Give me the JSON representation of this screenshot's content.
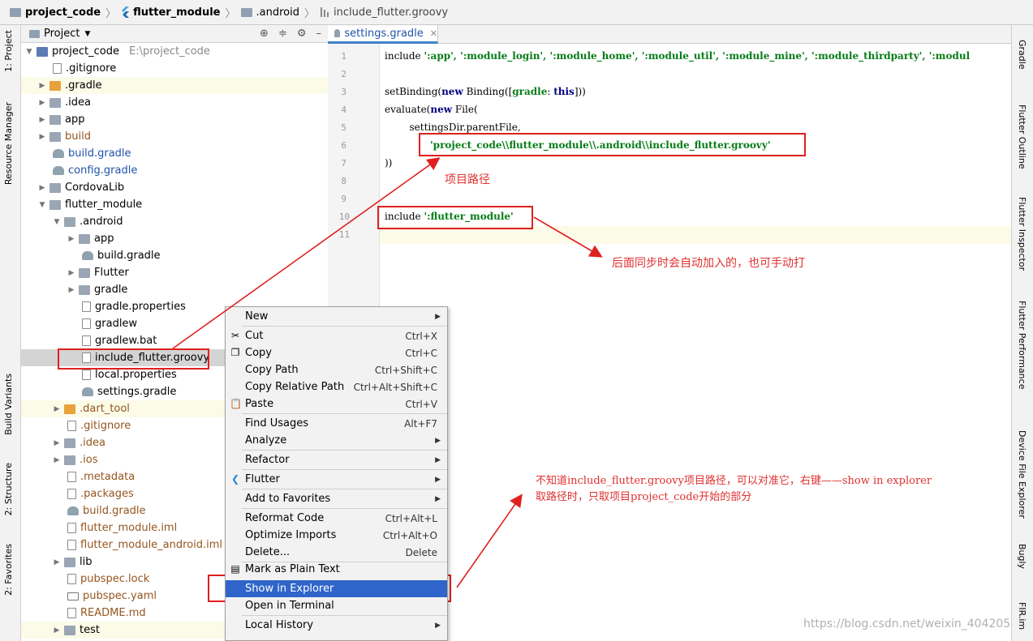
{
  "breadcrumb": {
    "root": "project_code",
    "module": "flutter_module",
    "android": ".android",
    "file": "include_flutter.groovy"
  },
  "left_tool_tabs": {
    "project": "1: Project",
    "resource_manager": "Resource Manager",
    "build_variants": "Build Variants",
    "structure": "2: Structure",
    "favorites": "2: Favorites"
  },
  "right_tool_tabs": {
    "gradle": "Gradle",
    "flutter_outline": "Flutter Outline",
    "flutter_inspector": "Flutter Inspector",
    "flutter_performance": "Flutter Performance",
    "device_file_explorer": "Device File Explorer",
    "bugly": "Bugly",
    "fir": "FIR.im"
  },
  "project_panel": {
    "title": "Project",
    "root_path": "E:\\project_code"
  },
  "tree": [
    "project_code",
    ".gitignore",
    ".gradle",
    ".idea",
    "app",
    "build",
    "build.gradle",
    "config.gradle",
    "CordovaLib",
    "flutter_module",
    ".android",
    "app",
    "build.gradle",
    "Flutter",
    "gradle",
    "gradle.properties",
    "gradlew",
    "gradlew.bat",
    "include_flutter.groovy",
    "local.properties",
    "settings.gradle",
    ".dart_tool",
    ".gitignore",
    ".idea",
    ".ios",
    ".metadata",
    ".packages",
    "build.gradle",
    "flutter_module.iml",
    "flutter_module_android.iml",
    "lib",
    "pubspec.lock",
    "pubspec.yaml",
    "README.md",
    "test"
  ],
  "editor": {
    "tab": "settings.gradle",
    "line_numbers": [
      "1",
      "2",
      "3",
      "4",
      "5",
      "6",
      "7",
      "8",
      "9",
      "10",
      "11"
    ],
    "lines": {
      "l1_a": "include ",
      "l1_b": "':app', ':module_login', ':module_home', ':module_util', ':module_mine', ':module_thirdparty', ':modul",
      "l3_a": "setBinding(",
      "l3_new": "new",
      "l3_b": " Binding([",
      "l3_gradle": "gradle",
      "l3_c": ": ",
      "l3_this": "this",
      "l3_d": "]))",
      "l4_a": "evaluate(",
      "l4_new": "new",
      "l4_b": " File(",
      "l5": "        settingsDir.parentFile,",
      "l6": "'project_code\\\\flutter_module\\\\.android\\\\include_flutter.groovy'",
      "l7": "))",
      "l10_a": "include ",
      "l10_b": "':flutter_module'"
    }
  },
  "annotations": {
    "path_note": "项目路径",
    "sync_note": "后面同步时会自动加入的，也可手动打",
    "explorer_note_1": "不知道include_flutter.groovy项目路径，可以对准它，右键——show in explorer",
    "explorer_note_2": "取路径时，只取项目project_code开始的部分"
  },
  "context_menu": {
    "new": "New",
    "cut": "Cut",
    "cut_sc": "Ctrl+X",
    "copy": "Copy",
    "copy_sc": "Ctrl+C",
    "copy_path": "Copy Path",
    "copy_path_sc": "Ctrl+Shift+C",
    "copy_rel": "Copy Relative Path",
    "copy_rel_sc": "Ctrl+Alt+Shift+C",
    "paste": "Paste",
    "paste_sc": "Ctrl+V",
    "find_usages": "Find Usages",
    "find_usages_sc": "Alt+F7",
    "analyze": "Analyze",
    "refactor": "Refactor",
    "flutter": "Flutter",
    "add_fav": "Add to Favorites",
    "reformat": "Reformat Code",
    "reformat_sc": "Ctrl+Alt+L",
    "optimize": "Optimize Imports",
    "optimize_sc": "Ctrl+Alt+O",
    "delete": "Delete...",
    "delete_sc": "Delete",
    "mark_plain": "Mark as Plain Text",
    "show_explorer": "Show in Explorer",
    "open_terminal": "Open in Terminal",
    "local_history": "Local History"
  },
  "watermark": "https://blog.csdn.net/weixin_404205",
  "colors": {
    "accent_red": "#e02020",
    "menu_selected": "#2f65ca"
  }
}
